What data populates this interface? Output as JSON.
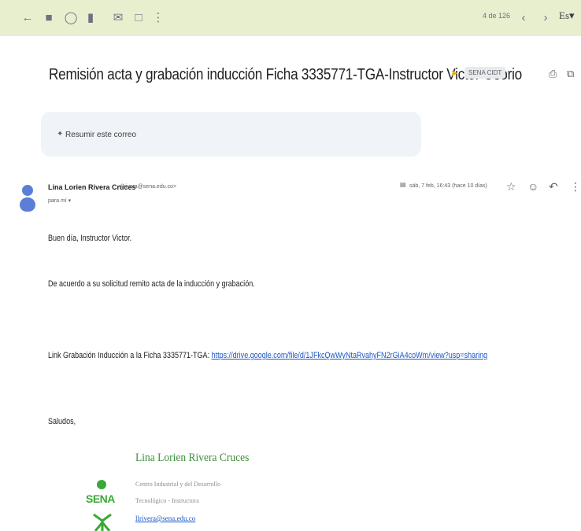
{
  "toolbar": {
    "count": "4 de 126",
    "language": "Es"
  },
  "email": {
    "subject": "Remisión acta y grabación inducción Ficha 3335771-TGA-Instructor Victor Osorio",
    "label": "SENA CIDT",
    "summarize": "Resumir este correo",
    "sender_name": "Lina Lorien Rivera Cruces",
    "sender_email": "<llrivera@sena.edu.co>",
    "to": "para mí",
    "date": "sáb, 7 feb, 16:43 (hace 10 días)",
    "body": {
      "greeting": "Buen día, Instructor Victor.",
      "line1": "De acuerdo a su solicitud remito acta de la inducción y grabación.",
      "link_label": "Link Grabación Inducción a la Ficha 3335771-TGA:",
      "link_url": "https://drive.google.com/file/d/1JFkcQwWyNtaRvahyFN2rGiA4coWm/view?usp=sharing",
      "closing": "Saludos,"
    },
    "signature": {
      "logo_text": "SENA",
      "name": "Lina Lorien Rivera Cruces",
      "line1": "Centro Industrial y del Desarrollo",
      "line2": "Tecnológico - Instructora",
      "email": "llrivera@sena.edu.co"
    }
  },
  "colors": {
    "toolbar_bg": "#e7efcf",
    "link": "#1a56c4",
    "sena_green": "#39a935",
    "avatar": "#5b7fd6",
    "label_marker": "#f2b600"
  },
  "icons": [
    "back-arrow-icon",
    "archive-icon",
    "report-spam-icon",
    "delete-icon",
    "mark-unread-icon",
    "move-to-icon",
    "more-vert-icon",
    "prev-icon",
    "next-icon",
    "print-icon",
    "open-new-window-icon",
    "attachment-icon",
    "star-icon",
    "emoji-icon",
    "reply-icon",
    "more-icon"
  ]
}
